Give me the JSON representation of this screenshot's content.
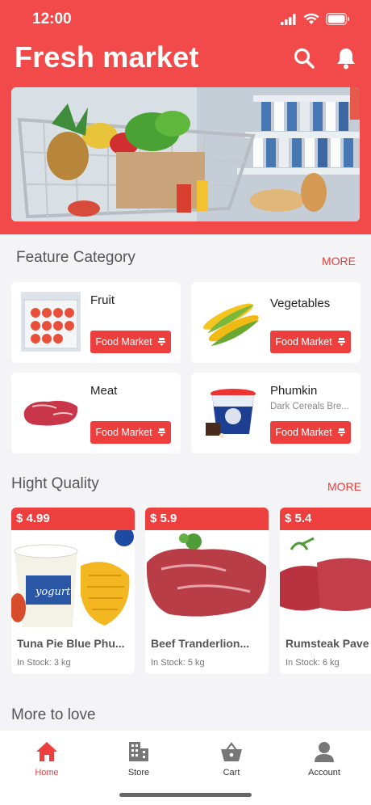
{
  "status_bar": {
    "time": "12:00"
  },
  "header": {
    "title": "Fresh market"
  },
  "sections": {
    "feature": {
      "title": "Feature Category",
      "more": "MORE"
    },
    "quality": {
      "title": "Hight Quality",
      "more": "MORE"
    },
    "love": {
      "title": "More to love"
    }
  },
  "categories": [
    {
      "name": "Fruit",
      "sub": "",
      "button": "Food Market"
    },
    {
      "name": "Vegetables",
      "sub": "",
      "button": "Food Market"
    },
    {
      "name": "Meat",
      "sub": "",
      "button": "Food Market"
    },
    {
      "name": "Phumkin",
      "sub": "Dark Cereals Bre...",
      "button": "Food Market"
    }
  ],
  "products": [
    {
      "price": "$ 4.99",
      "name": "Tuna Pie Blue Phu...",
      "stock": "In Stock: 3  kg",
      "jar_label": "yogurt"
    },
    {
      "price": "$ 5.9",
      "name": "Beef Tranderlion...",
      "stock": "In Stock: 5  kg"
    },
    {
      "price": "$ 5.4",
      "name": "Rumsteak Pave",
      "stock": "In Stock: 6  kg"
    }
  ],
  "nav": {
    "home": "Home",
    "store": "Store",
    "cart": "Cart",
    "account": "Account"
  },
  "colors": {
    "primary": "#f24a4a",
    "button": "#ee3f3f"
  }
}
